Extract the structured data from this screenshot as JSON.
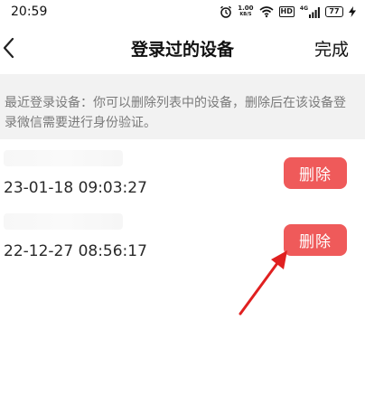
{
  "status_bar": {
    "time": "20:59",
    "net_speed_value": "1.00",
    "net_speed_unit": "KB/S",
    "hd_label": "HD",
    "signal_label": "4G",
    "battery_level": "77"
  },
  "nav": {
    "title": "登录过的设备",
    "done_label": "完成"
  },
  "notice": {
    "text": "最近登录设备：你可以删除列表中的设备，删除后在该设备登录微信需要进行身份验证。"
  },
  "devices": [
    {
      "time": "23-01-18 09:03:27",
      "delete_label": "删除"
    },
    {
      "time": "22-12-27 08:56:17",
      "delete_label": "删除"
    }
  ],
  "colors": {
    "accent": "#ef5a5a",
    "arrow": "#e02020",
    "notice_bg": "#f2f2f2"
  }
}
